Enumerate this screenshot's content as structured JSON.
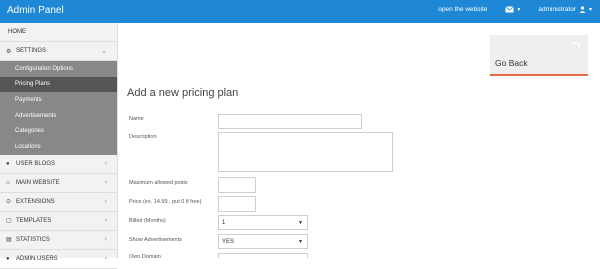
{
  "topbar": {
    "title": "Admin Panel",
    "open_website": "open the website",
    "mail_caret": "▾",
    "user": "administrator",
    "user_caret": "▾"
  },
  "sidebar": {
    "home": "HOME",
    "settings": "SETTINGS",
    "settings_sub": [
      "Configuration Options",
      "Pricing Plans",
      "Payments",
      "Advertisements",
      "Categories",
      "Locations"
    ],
    "items": [
      "USER BLOGS",
      "MAIN WEBSITE",
      "EXTENSIONS",
      "TEMPLATES",
      "STATISTICS",
      "ADMIN USERS"
    ]
  },
  "main": {
    "go_back": "Go Back",
    "title": "Add a new pricing plan",
    "fields": {
      "name": "Name",
      "description": "Description",
      "max_posts": "Maximum allowed posts",
      "price": "Price (ex. 14.99 , put 0 if free)",
      "billed": "Billed (Months)",
      "billed_value": "1",
      "show_ads": "Show Advertisements",
      "show_ads_value": "YES",
      "own_domain": "Own Domain"
    }
  },
  "colors": {
    "topbar": "#1e88d6",
    "active_sub": "#555555",
    "sub_bg": "#888888",
    "goback_accent": "#e26a4a"
  }
}
